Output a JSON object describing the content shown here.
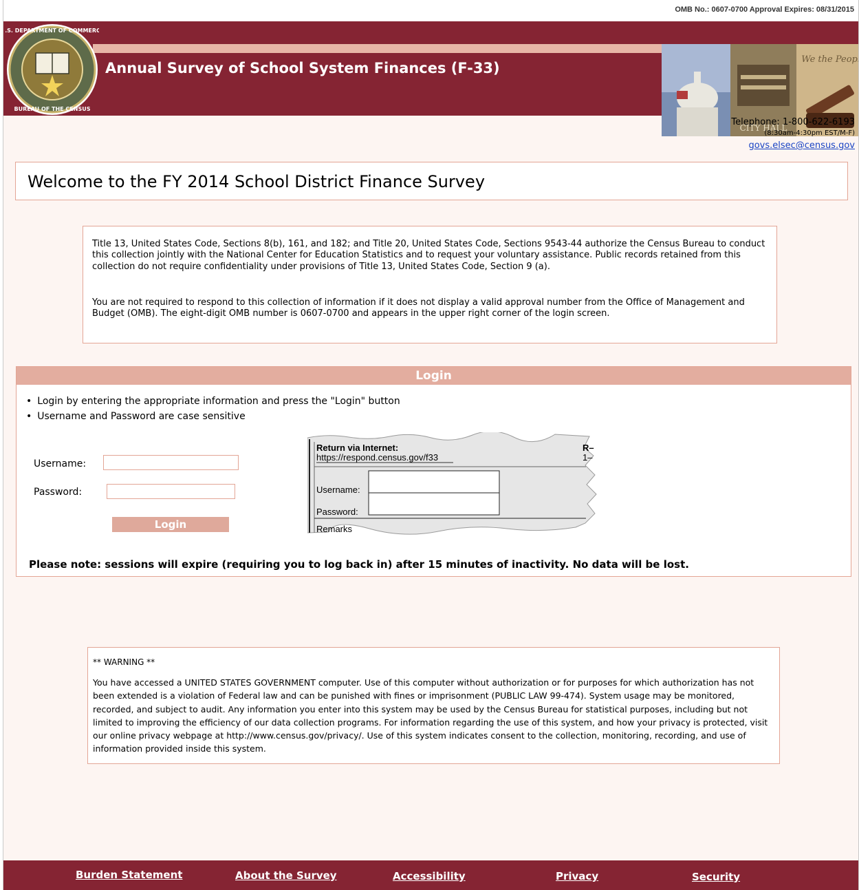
{
  "header": {
    "omb_notice": "OMB No.: 0607-0700 Approval Expires: 08/31/2015",
    "title": "Annual Survey of School System Finances (F-33)",
    "seal_text": "U.S. DEPARTMENT OF COMMERCE · BUREAU OF THE CENSUS",
    "photo_city_hall_text": "CITY HALL",
    "photo_constitution_text": "We the People"
  },
  "contact": {
    "telephone": "Telephone: 1-800-622-6193",
    "hours": "(8:30am-4:30pm EST/M-F)",
    "email": "govs.elsec@census.gov"
  },
  "welcome": {
    "heading": "Welcome to the FY 2014 School District Finance Survey"
  },
  "authority": {
    "paragraph1": "Title 13, United States Code, Sections 8(b), 161, and 182; and Title 20, United States Code, Sections 9543-44 authorize the Census Bureau to conduct this collection jointly with the National Center for Education Statistics and to request your voluntary assistance. Public records retained from this collection do not require confidentiality under provisions of Title 13, United States Code, Section 9 (a).",
    "paragraph2": "You are not required to respond to this collection of information if it does not display a valid approval number from the Office of Management and Budget (OMB). The eight-digit OMB number is 0607-0700 and appears in the upper right corner of the login screen."
  },
  "login": {
    "heading": "Login",
    "instructions": [
      "Login by entering the appropriate information and press the \"Login\" button",
      "Username and Password are case sensitive"
    ],
    "username_label": "Username:",
    "username_value": "",
    "password_label": "Password:",
    "password_value": "",
    "button_label": "Login",
    "note": "Please note: sessions will expire (requiring you to log back in) after 15 minutes of inactivity. No data will be lost."
  },
  "sample_form": {
    "title": "Return via Internet:",
    "url": "https://respond.census.gov/f33",
    "username_label": "Username:",
    "password_label": "Password:",
    "remarks_label": "Remarks",
    "corner_text": "R–",
    "corner_text2": "1–"
  },
  "warning": {
    "title": "** WARNING **",
    "body": "You have accessed a UNITED STATES GOVERNMENT computer. Use of this computer without authorization or for purposes for which authorization has not been extended is a violation of Federal law and can be punished with fines or imprisonment (PUBLIC LAW 99-474). System usage may be monitored, recorded, and subject to audit. Any information you enter into this system may be used by the Census Bureau for statistical purposes, including but not limited to improving the efficiency of our data collection programs. For information regarding the use of this system, and how your privacy is protected, visit our online privacy webpage at http://www.census.gov/privacy/. Use of this system indicates consent to the collection, monitoring, recording, and use of information provided inside this system."
  },
  "footer": {
    "links": [
      "Burden Statement",
      "About the Survey",
      "Accessibility",
      "Privacy",
      "Security"
    ]
  },
  "colors": {
    "banner": "#852433",
    "accent": "#e3ad9f",
    "page_background": "#fdf5f2",
    "link": "#1a44c4"
  }
}
